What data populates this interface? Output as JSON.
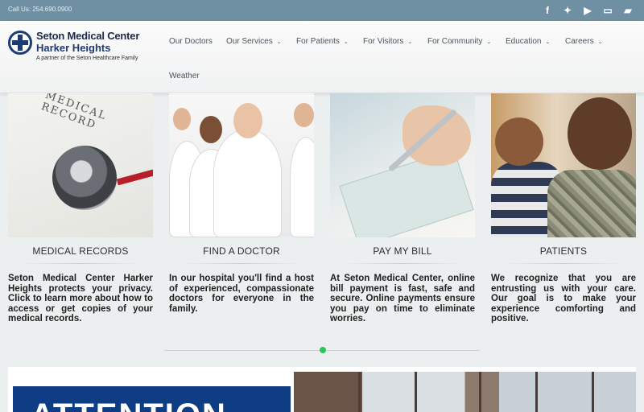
{
  "topbar": {
    "call_text": "Call Us: 254.690.0900",
    "social_icons": [
      "facebook-icon",
      "twitter-icon",
      "youtube-icon",
      "payment-card-icon",
      "folder-icon"
    ],
    "background": "#6f8fa3"
  },
  "logo": {
    "title": "Seton Medical Center",
    "subtitle": "Harker Heights",
    "tagline": "A partner of the Seton Healthcare Family",
    "brand_color": "#1b3c74"
  },
  "nav": {
    "items": [
      {
        "label": "Our Doctors",
        "has_dropdown": false
      },
      {
        "label": "Our Services",
        "has_dropdown": true
      },
      {
        "label": "For Patients",
        "has_dropdown": true
      },
      {
        "label": "For Visitors",
        "has_dropdown": true
      },
      {
        "label": "For Community",
        "has_dropdown": true
      },
      {
        "label": "Education",
        "has_dropdown": true
      },
      {
        "label": "Careers",
        "has_dropdown": true
      },
      {
        "label": "Weather",
        "has_dropdown": false
      }
    ],
    "dropdown_glyph": "⌄"
  },
  "features": [
    {
      "title": "MEDICAL RECORDS",
      "photo_text": "MEDICAL RECORD",
      "description": "Seton Medical Center Harker Heights protects your privacy. Click to learn more about how to access or get copies of your medical records."
    },
    {
      "title": "FIND A DOCTOR",
      "description": "In our hospital you'll find a host of experienced, compassionate doctors for everyone in the family."
    },
    {
      "title": "PAY MY BILL",
      "description": "At Seton Medical Center, online bill payment is fast, safe and secure. Online payments ensure you pay on time to eliminate worries."
    },
    {
      "title": "PATIENTS",
      "description": "We recognize that you are entrusting us with your care. Our goal is to make your experience comforting and positive."
    }
  ],
  "bottom": {
    "banner_text": "ATTENTION",
    "banner_color": "#0e3d83"
  }
}
